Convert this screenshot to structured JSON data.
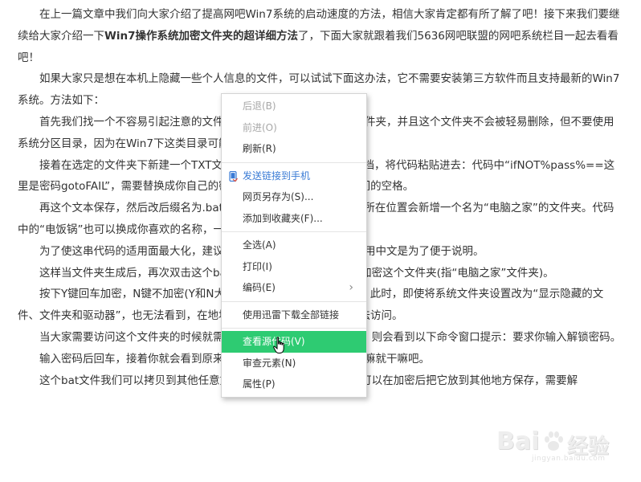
{
  "article": {
    "p1_before": "在上一篇文章中我们向大家介绍了提高网吧Win7系统的启动速度的方法，相信大家肯定都有所了解了吧！接下来我们要继续给大家介绍一下",
    "p1_bold": "Win7操作系统加密文件夹的超详细方法",
    "p1_after": "了，下面大家就跟着我们5636网吧联盟的网吧系统栏目一起去看看吧！",
    "p2": "如果大家只是想在本机上隐藏一些个人信息的文件，可以试试下面这办法，它不需要安装第三方软件而且支持最新的Win7系统。方法如下：",
    "p3": "首先我们找一个不容易引起注意的文件夹，在里面新建一个同类的文件夹，并且这个文件夹不会被轻易删除，但不要使用系统分区目录，因为在Win7下这类目录可能导致加密失败。",
    "p4": "接着在选定的文件夹下新建一个TXT文本文档，用记事本打开这个文档，将代码粘贴进去：代码中“ifNOT%pass%==这里是密码gotoFAIL”，需要替换成你自己的密码组合，注意保留和等号之间的空格。",
    "p5": "再这个文本保存，然后改后缀名为.bat，双击运行一次，此时该文件所在位置会新增一个名为“电脑之家”的文件夹。代码中的“电饭锅”也可以换成你喜欢的名称，一共有6处，注意不要遗漏。",
    "p6": "为了使这串代码的适用面最大化，建议使用英文名字，这里文件夹改用中文是为了便于说明。",
    "p7": "这样当文件夹生成后，再次双击这个bat文件，系统会询问你是否要加密这个文件夹(指“电脑之家”文件夹)。",
    "p8": "按下Y键回车加密，N键不加密(Y和N大小写均可)，文件夹就会消失。此时，即使将系统文件夹设置改为“显示隐藏的文件、文件夹和驱动器”，也无法看到，在地址栏直接输入文件夹名称也无法访问。",
    "p9": "当大家需要访问这个文件夹的时候就需要先解密，仍然双击bat文件，则会看到以下命令窗口提示：要求你输入解锁密码。",
    "p10": "输入密码后回车，接着你就会看到原来的文件又出现了，然后你该干嘛就干嘛吧。",
    "p11": "这个bat文件我们可以拷贝到其他任意文件夹下使用，所以我们完全可以在加密后把它放到其他地方保存，需要解"
  },
  "context_menu": {
    "back": "后退(B)",
    "forward": "前进(O)",
    "refresh": "刷新(R)",
    "send_to_phone": "发送链接到手机",
    "save_as": "网页另存为(S)...",
    "add_favorite": "添加到收藏夹(F)...",
    "select_all": "全选(A)",
    "print": "打印(I)",
    "encoding": "编码(E)",
    "download_all": "使用迅雷下载全部链接",
    "view_source": "查看源代码(V)",
    "inspect": "审查元素(N)",
    "properties": "属性(P)"
  },
  "watermark": {
    "brand": "Bai",
    "brand2": "经验",
    "url": "jingyan.baidu.com"
  },
  "colors": {
    "highlight": "#2ecb72",
    "phone_icon": "#3a7bd5"
  }
}
